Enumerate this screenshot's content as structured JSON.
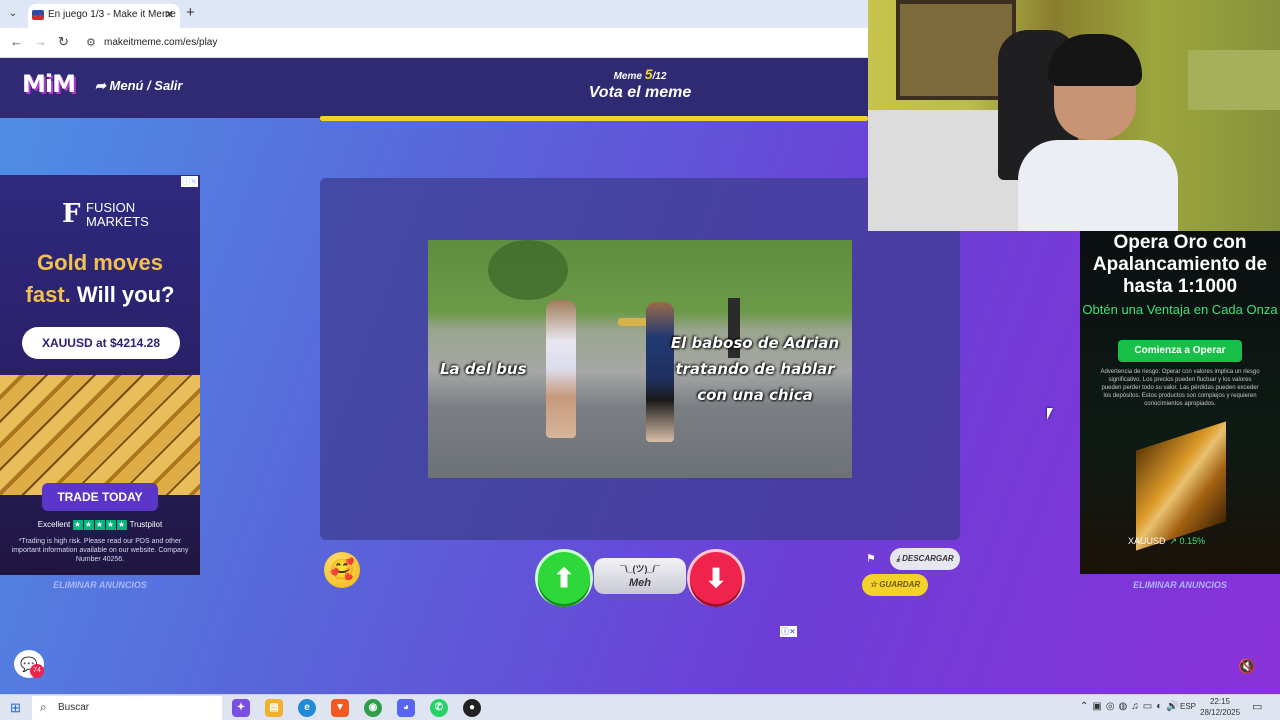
{
  "browser": {
    "tab_title": "En juego 1/3 - Make it Meme",
    "tab_close": "✕",
    "new_tab": "+",
    "url": "makeitmeme.com/es/play"
  },
  "header": {
    "logo": "MiM",
    "menu_exit": "➦ Menú / Salir",
    "meme_prefix": "Meme ",
    "meme_current": "5",
    "meme_total": "/12",
    "title": "Vota el meme",
    "progress": 1.0
  },
  "ad_left": {
    "choice": "ⓘ⨯",
    "brand_letter": "F",
    "brand_line1": "FUSION",
    "brand_line2": "MARKETS",
    "headline_gold1": "Gold moves",
    "headline_gold2": "fast.",
    "headline_white": " Will you?",
    "pill": "XAUUSD at $4214.28",
    "cta": "TRADE TODAY",
    "rating_label": "Excellent",
    "trustpilot": "Trustpilot",
    "disclaimer": "*Trading is high risk. Please read our PDS and other important information available on our website. Company Number 40256.",
    "remove_ads": "ELIMINAR ANUNCIOS"
  },
  "meme": {
    "caption_left": "La del bus",
    "caption_right": "El baboso de Adrian tratando de hablar con una chica"
  },
  "controls": {
    "emoji": "🥰",
    "upvote_icon": "⬆",
    "meh_face": "¯\\_(ツ)_/¯",
    "meh_label": "Meh",
    "downvote_icon": "⬇",
    "flag_icon": "⚑",
    "download": "⤓ DESCARGAR",
    "save": "☆ GUARDAR",
    "ad_choice": "ⓘ⨯",
    "chat_icon": "💬",
    "chat_count": "74",
    "mute_icon": "🔇"
  },
  "ad_right": {
    "headline": "Opera Oro con Apalancamiento de hasta 1:1000",
    "sub": "Obtén una Ventaja en Cada Onza",
    "cta": "Comienza a Operar",
    "disclaimer": "Advertencia de riesgo: Operar con valores implica un riesgo significativo. Los precios pueden fluctuar y los valores pueden perder todo su valor. Las pérdidas pueden exceder los depósitos. Estos productos son complejos y requieren conocimientos apropiados.",
    "ticker_symbol": "XAUUSD",
    "ticker_change": "↗ 0.15%",
    "remove_ads": "ELIMINAR ANUNCIOS"
  },
  "taskbar": {
    "search": "Buscar",
    "lang": "ESP",
    "time": "22:15",
    "date": "28/12/2025"
  }
}
